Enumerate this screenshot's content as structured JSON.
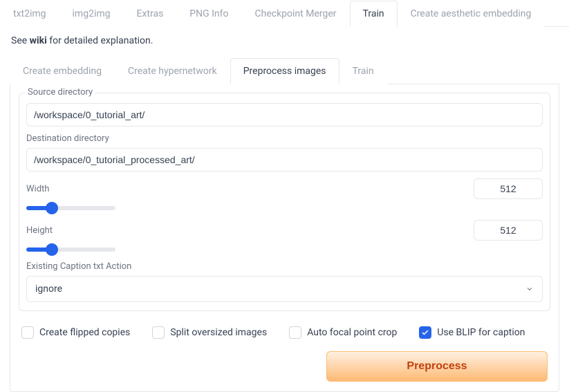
{
  "top_tabs": {
    "items": [
      "txt2img",
      "img2img",
      "Extras",
      "PNG Info",
      "Checkpoint Merger",
      "Train",
      "Create aesthetic embedding"
    ],
    "active_index": 5
  },
  "hint_prefix": "See ",
  "hint_wiki": "wiki",
  "hint_suffix": " for detailed explanation.",
  "sub_tabs": {
    "items": [
      "Create embedding",
      "Create hypernetwork",
      "Preprocess images",
      "Train"
    ],
    "active_index": 2
  },
  "fields": {
    "source": {
      "label": "Source directory",
      "value": "/workspace/0_tutorial_art/"
    },
    "destination": {
      "label": "Destination directory",
      "value": "/workspace/0_tutorial_processed_art/"
    },
    "width": {
      "label": "Width",
      "value": "512"
    },
    "height": {
      "label": "Height",
      "value": "512"
    },
    "caption_action": {
      "label": "Existing Caption txt Action",
      "value": "ignore"
    }
  },
  "checks": {
    "flipped": {
      "label": "Create flipped copies",
      "checked": false
    },
    "split": {
      "label": "Split oversized images",
      "checked": false
    },
    "focal": {
      "label": "Auto focal point crop",
      "checked": false
    },
    "blip": {
      "label": "Use BLIP for caption",
      "checked": true
    }
  },
  "button": {
    "label": "Preprocess"
  }
}
